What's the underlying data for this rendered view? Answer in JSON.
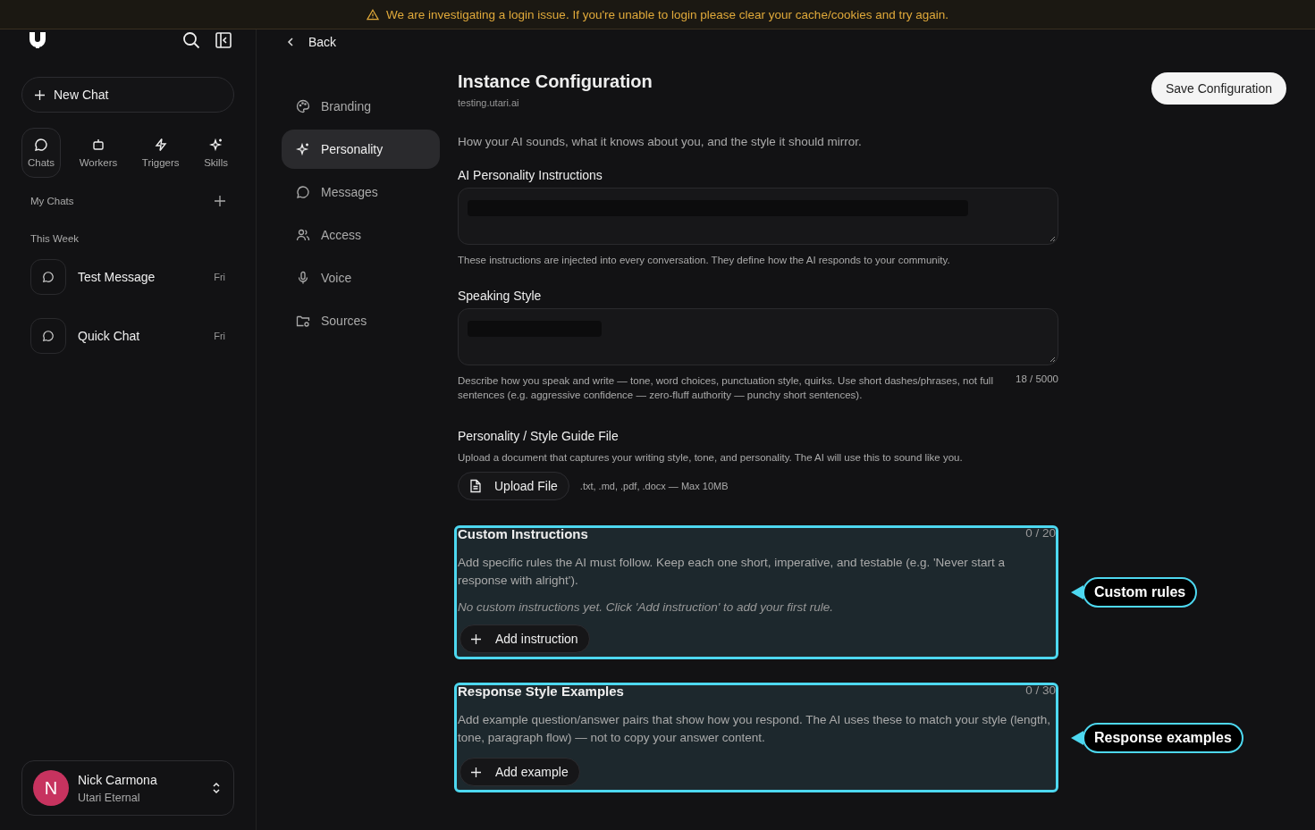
{
  "banner": {
    "text": "We are investigating a login issue. If you're unable to login please clear your cache/cookies and try again."
  },
  "sidebar": {
    "new_chat": "New Chat",
    "nav": [
      {
        "label": "Chats",
        "selected": true
      },
      {
        "label": "Workers",
        "selected": false
      },
      {
        "label": "Triggers",
        "selected": false
      },
      {
        "label": "Skills",
        "selected": false
      }
    ],
    "my_chats": "My Chats",
    "group": "This Week",
    "chats": [
      {
        "title": "Test Message",
        "day": "Fri"
      },
      {
        "title": "Quick Chat",
        "day": "Fri"
      }
    ],
    "user": {
      "initial": "N",
      "name": "Nick Carmona",
      "org": "Utari Eternal"
    }
  },
  "back": "Back",
  "settings_nav": [
    {
      "label": "Branding",
      "selected": false
    },
    {
      "label": "Personality",
      "selected": true
    },
    {
      "label": "Messages",
      "selected": false
    },
    {
      "label": "Access",
      "selected": false
    },
    {
      "label": "Voice",
      "selected": false
    },
    {
      "label": "Sources",
      "selected": false
    }
  ],
  "header": {
    "title": "Instance Configuration",
    "subtitle": "testing.utari.ai",
    "save": "Save Configuration"
  },
  "section_description": "How your AI sounds, what it knows about you, and the style it should mirror.",
  "fields": [
    {
      "label": "AI Personality Instructions",
      "help": "These instructions are injected into every conversation. They define how the AI responds to your community."
    },
    {
      "label": "Speaking Style",
      "help": "Describe how you speak and write — tone, word choices, punctuation style, quirks. Use short dashes/phrases, not full sentences (e.g. aggressive confidence — zero-fluff authority — punchy short sentences).",
      "counter": "18 / 5000"
    }
  ],
  "upload": {
    "label": "Personality / Style Guide File",
    "description": "Upload a document that captures your writing style, tone, and personality. The AI will use this to sound like you.",
    "button": "Upload File",
    "hint": ".txt, .md, .pdf, .docx — Max 10MB"
  },
  "panels": [
    {
      "title": "Custom Instructions",
      "count": "0 / 20",
      "description": "Add specific rules the AI must follow. Keep each one short, imperative, and testable (e.g. 'Never start a response with alright').",
      "empty": "No custom instructions yet. Click 'Add instruction' to add your first rule.",
      "button": "Add instruction",
      "callout": "Custom rules"
    },
    {
      "title": "Response Style Examples",
      "count": "0 / 30",
      "description": "Add example question/answer pairs that show how you respond. The AI uses these to match your style (length, tone, paragraph flow) — not to copy your answer content.",
      "button": "Add example",
      "callout": "Response examples"
    }
  ]
}
